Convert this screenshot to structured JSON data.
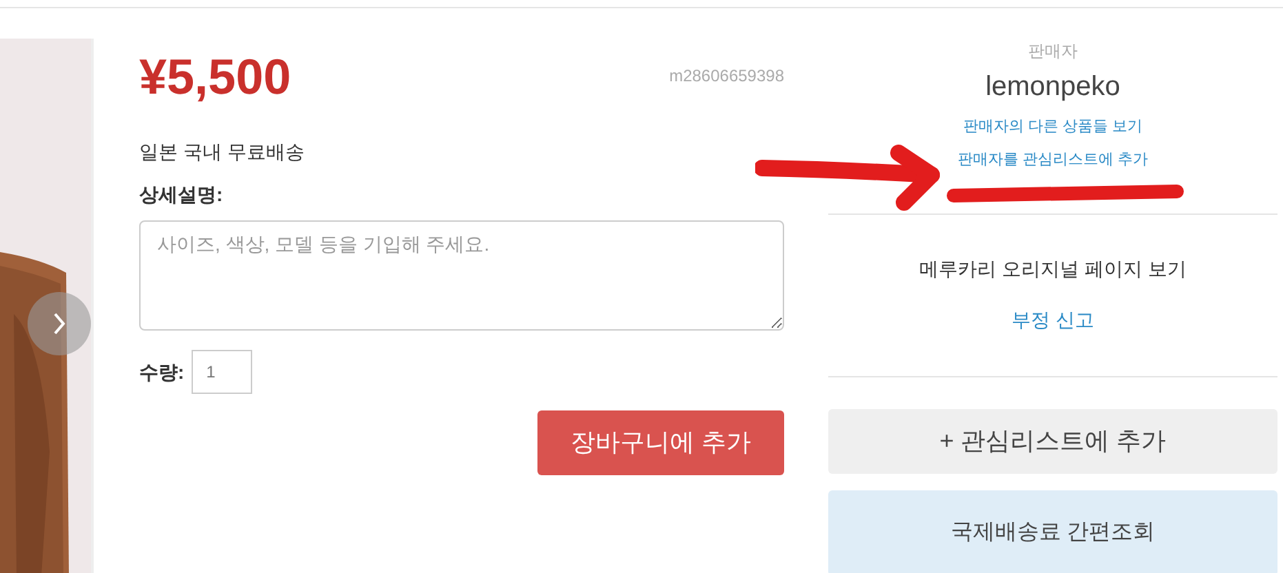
{
  "price": "¥5,500",
  "item_id": "m28606659398",
  "shipping_note": "일본 국내 무료배송",
  "description": {
    "label": "상세설명:",
    "placeholder": "사이즈, 색상, 모델 등을 기입해 주세요."
  },
  "quantity": {
    "label": "수량:",
    "value": "1"
  },
  "add_to_cart_button": "장바구니에 추가",
  "seller": {
    "heading": "판매자",
    "name": "lemonpeko",
    "links": [
      "판매자의 다른 상품들 보기",
      "판매자를 관심리스트에 추가"
    ]
  },
  "original_page_link": "메루카리 오리지널 페이지 보기",
  "report_link": "부정 신고",
  "watchlist_button": "+ 관심리스트에 추가",
  "shipping_calc_button": "국제배송료 간편조회"
}
